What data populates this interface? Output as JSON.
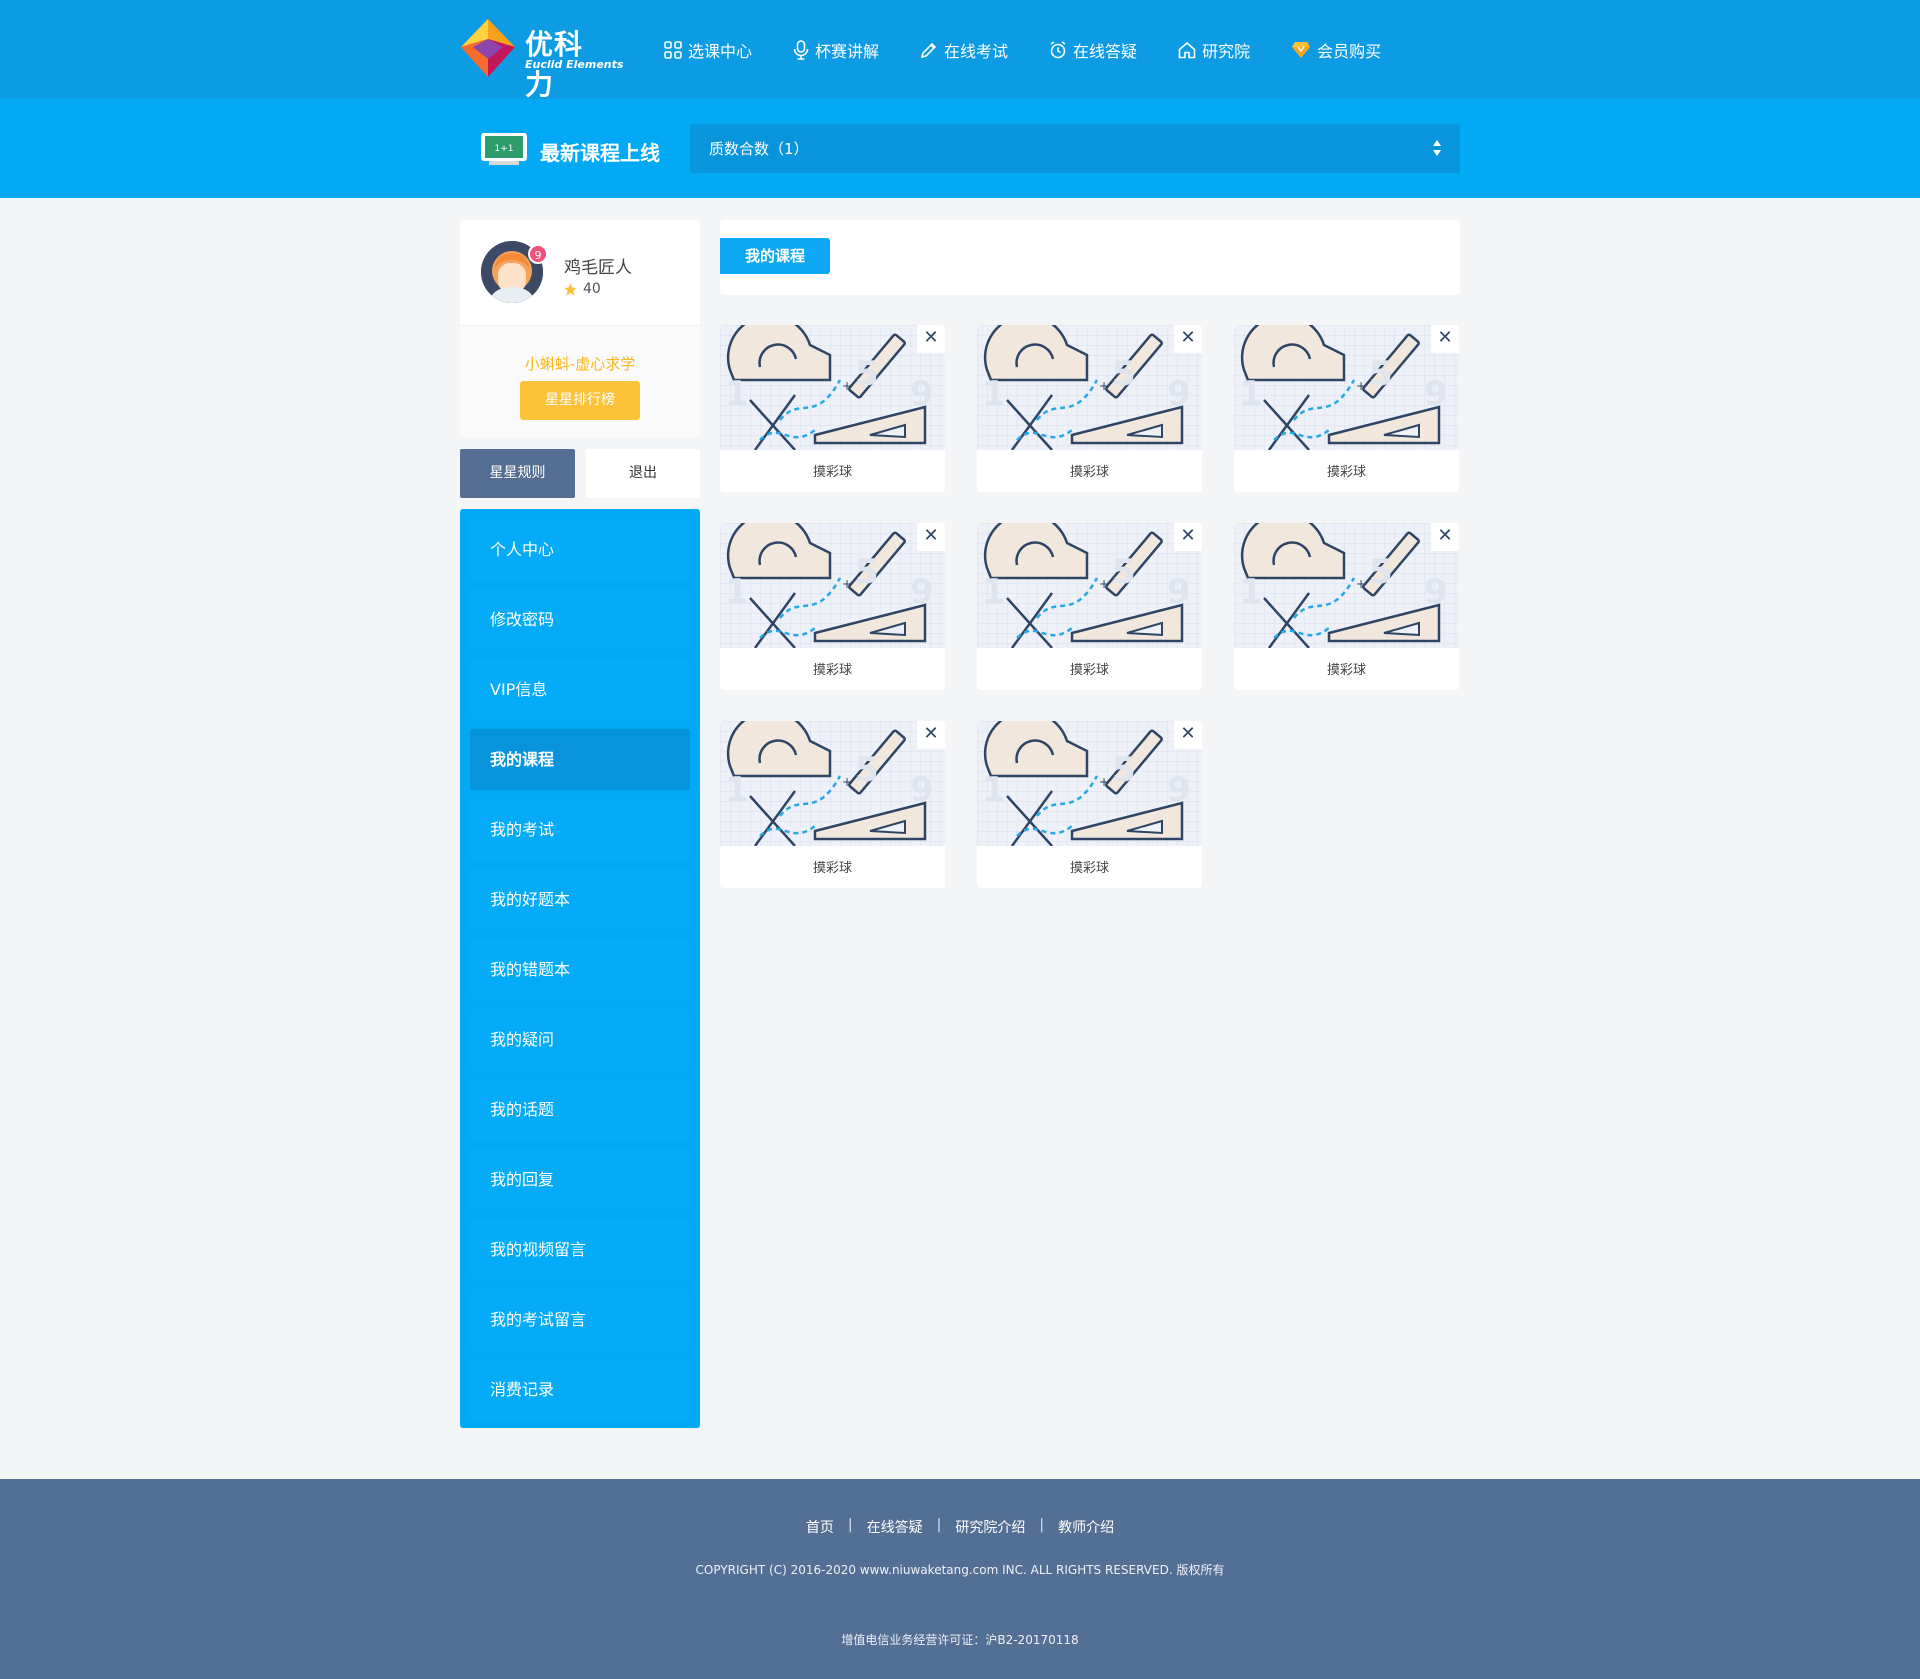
{
  "brand": {
    "name": "优科力",
    "tagline": "Euclid Elements"
  },
  "nav": [
    {
      "label": "选课中心",
      "icon": "grid-icon"
    },
    {
      "label": "杯赛讲解",
      "icon": "microphone-icon"
    },
    {
      "label": "在线考试",
      "icon": "pencil-icon"
    },
    {
      "label": "在线答疑",
      "icon": "alarm-icon"
    },
    {
      "label": "研究院",
      "icon": "home-icon"
    },
    {
      "label": "会员购买",
      "icon": "diamond-icon"
    }
  ],
  "latest": {
    "title": "最新课程上线",
    "selected_course": "质数合数（1）"
  },
  "profile": {
    "username": "鸡毛匠人",
    "stars": "40",
    "notification_count": "9",
    "rank_title": "小蝌蚪-虚心求学",
    "rank_button": "星星排行榜"
  },
  "actions": {
    "rules": "星星规则",
    "logout": "退出"
  },
  "menu": [
    {
      "label": "个人中心"
    },
    {
      "label": "修改密码"
    },
    {
      "label": "VIP信息"
    },
    {
      "label": "我的课程",
      "active": true
    },
    {
      "label": "我的考试"
    },
    {
      "label": "我的好题本"
    },
    {
      "label": "我的错题本"
    },
    {
      "label": "我的疑问"
    },
    {
      "label": "我的话题"
    },
    {
      "label": "我的回复"
    },
    {
      "label": "我的视频留言"
    },
    {
      "label": "我的考试留言"
    },
    {
      "label": "消费记录"
    }
  ],
  "content": {
    "tab": "我的课程",
    "courses": [
      {
        "title": "摸彩球"
      },
      {
        "title": "摸彩球"
      },
      {
        "title": "摸彩球"
      },
      {
        "title": "摸彩球"
      },
      {
        "title": "摸彩球"
      },
      {
        "title": "摸彩球"
      },
      {
        "title": "摸彩球"
      },
      {
        "title": "摸彩球"
      }
    ],
    "close_glyph": "✕"
  },
  "footer": {
    "links": [
      "首页",
      "在线答疑",
      "研究院介绍",
      "教师介绍"
    ],
    "separator": "|",
    "copyright": "COPYRIGHT (C) 2016-2020 www.niuwaketang.com INC. ALL RIGHTS RESERVED. 版权所有",
    "license": "增值电信业务经营许可证：沪B2-20170118"
  },
  "colors": {
    "topbar": "#0d9be3",
    "bar2": "#03a9f4",
    "menu": "#03a9f4",
    "menu_active": "#0894dc",
    "accent_yellow": "#fcc23a",
    "footer": "#546f94"
  }
}
